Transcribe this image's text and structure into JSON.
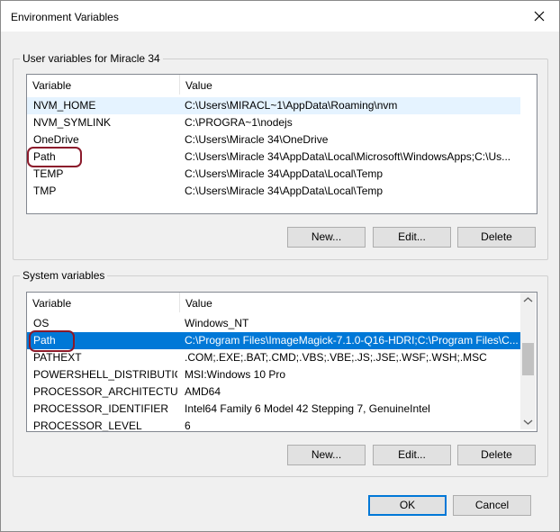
{
  "window": {
    "title": "Environment Variables"
  },
  "user_vars": {
    "group_label": "User variables for Miracle 34",
    "columns": [
      "Variable",
      "Value"
    ],
    "rows": [
      {
        "variable": "NVM_HOME",
        "value": "C:\\Users\\MIRACL~1\\AppData\\Roaming\\nvm"
      },
      {
        "variable": "NVM_SYMLINK",
        "value": "C:\\PROGRA~1\\nodejs"
      },
      {
        "variable": "OneDrive",
        "value": "C:\\Users\\Miracle 34\\OneDrive"
      },
      {
        "variable": "Path",
        "value": "C:\\Users\\Miracle 34\\AppData\\Local\\Microsoft\\WindowsApps;C:\\Us..."
      },
      {
        "variable": "TEMP",
        "value": "C:\\Users\\Miracle 34\\AppData\\Local\\Temp"
      },
      {
        "variable": "TMP",
        "value": "C:\\Users\\Miracle 34\\AppData\\Local\\Temp"
      }
    ],
    "buttons": {
      "new": "New...",
      "edit": "Edit...",
      "delete": "Delete"
    }
  },
  "system_vars": {
    "group_label": "System variables",
    "columns": [
      "Variable",
      "Value"
    ],
    "rows": [
      {
        "variable": "OS",
        "value": "Windows_NT"
      },
      {
        "variable": "Path",
        "value": "C:\\Program Files\\ImageMagick-7.1.0-Q16-HDRI;C:\\Program Files\\C...",
        "selected": true
      },
      {
        "variable": "PATHEXT",
        "value": ".COM;.EXE;.BAT;.CMD;.VBS;.VBE;.JS;.JSE;.WSF;.WSH;.MSC"
      },
      {
        "variable": "POWERSHELL_DISTRIBUTIO...",
        "value": "MSI:Windows 10 Pro"
      },
      {
        "variable": "PROCESSOR_ARCHITECTURE",
        "value": "AMD64"
      },
      {
        "variable": "PROCESSOR_IDENTIFIER",
        "value": "Intel64 Family 6 Model 42 Stepping 7, GenuineIntel"
      },
      {
        "variable": "PROCESSOR_LEVEL",
        "value": "6"
      }
    ],
    "buttons": {
      "new": "New...",
      "edit": "Edit...",
      "delete": "Delete"
    }
  },
  "footer": {
    "ok": "OK",
    "cancel": "Cancel"
  },
  "colors": {
    "selection": "#0078d7",
    "highlight_ring": "#8b1a2b"
  }
}
